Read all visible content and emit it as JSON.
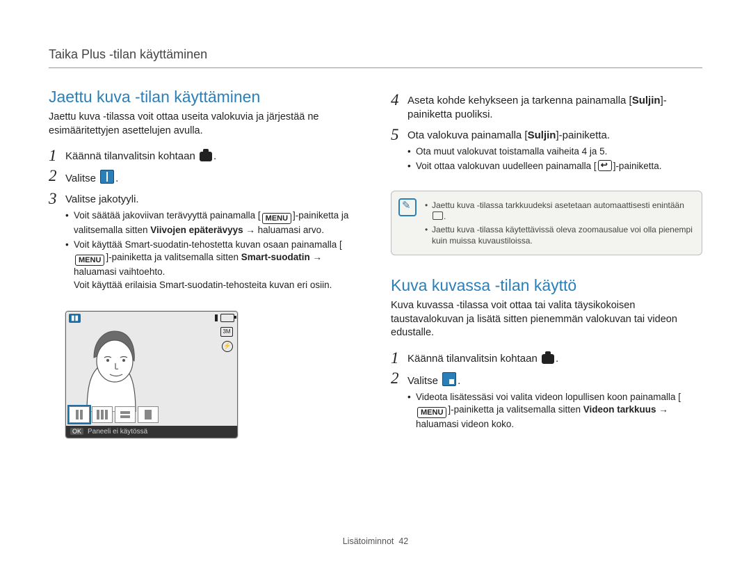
{
  "header": "Taika Plus -tilan käyttäminen",
  "left": {
    "title": "Jaettu kuva -tilan käyttäminen",
    "intro": "Jaettu kuva -tilassa voit ottaa useita valokuvia ja järjestää ne esimääritettyjen asettelujen avulla.",
    "steps": {
      "s1": {
        "num": "1",
        "pre": "Käännä tilanvalitsin kohtaan ",
        "post": "."
      },
      "s2": {
        "num": "2",
        "pre": "Valitse ",
        "post": "."
      },
      "s3": {
        "num": "3",
        "text": "Valitse jakotyyli.",
        "b1_pre": "Voit säätää jakoviivan terävyyttä painamalla [",
        "b1_menu": "MENU",
        "b1_mid": "]-painiketta ja valitsemalla sitten ",
        "b1_bold": "Viivojen epäterävyys",
        "b1_post": " → haluamasi arvo.",
        "b2_pre": "Voit käyttää Smart-suodatin-tehostetta kuvan osaan painamalla [",
        "b2_menu": "MENU",
        "b2_mid": "]-painiketta ja valitsemalla sitten ",
        "b2_bold": "Smart-suodatin",
        "b2_post": " → haluamasi vaihtoehto.",
        "b2_extra": "Voit käyttää erilaisia Smart-suodatin-tehosteita kuvan eri osiin."
      }
    },
    "preview": {
      "ok": "OK",
      "footer_text": "Paneeli ei käytössä"
    }
  },
  "right": {
    "steps_top": {
      "s4": {
        "num": "4",
        "pre": "Aseta kohde kehykseen ja tarkenna painamalla [",
        "bold": "Suljin",
        "post": "]-painiketta puoliksi."
      },
      "s5": {
        "num": "5",
        "pre": "Ota valokuva painamalla [",
        "bold": "Suljin",
        "post": "]-painiketta.",
        "b1": "Ota muut valokuvat toistamalla vaiheita 4 ja 5.",
        "b2_pre": "Voit ottaa valokuvan uudelleen painamalla [",
        "b2_post": "]-painiketta."
      }
    },
    "note": {
      "n1_pre": "Jaettu kuva -tilassa tarkkuudeksi asetetaan automaattisesti enintään ",
      "n1_post": ".",
      "n2": "Jaettu kuva -tilassa käytettävissä oleva zoomausalue voi olla pienempi kuin muissa kuvaustiloissa."
    },
    "section2": {
      "title": "Kuva kuvassa -tilan käyttö",
      "intro": "Kuva kuvassa -tilassa voit ottaa tai valita täysikokoisen taustavalokuvan ja lisätä sitten pienemmän valokuvan tai videon edustalle.",
      "s1": {
        "num": "1",
        "pre": "Käännä tilanvalitsin kohtaan ",
        "post": "."
      },
      "s2": {
        "num": "2",
        "pre": "Valitse ",
        "post": ".",
        "b_pre": "Videota lisätessäsi voi valita videon lopullisen koon painamalla [",
        "b_menu": "MENU",
        "b_mid": "]-painiketta ja valitsemalla sitten ",
        "b_bold": "Videon tarkkuus",
        "b_post": " → haluamasi videon koko."
      }
    }
  },
  "footer": {
    "label": "Lisätoiminnot",
    "page": "42"
  }
}
